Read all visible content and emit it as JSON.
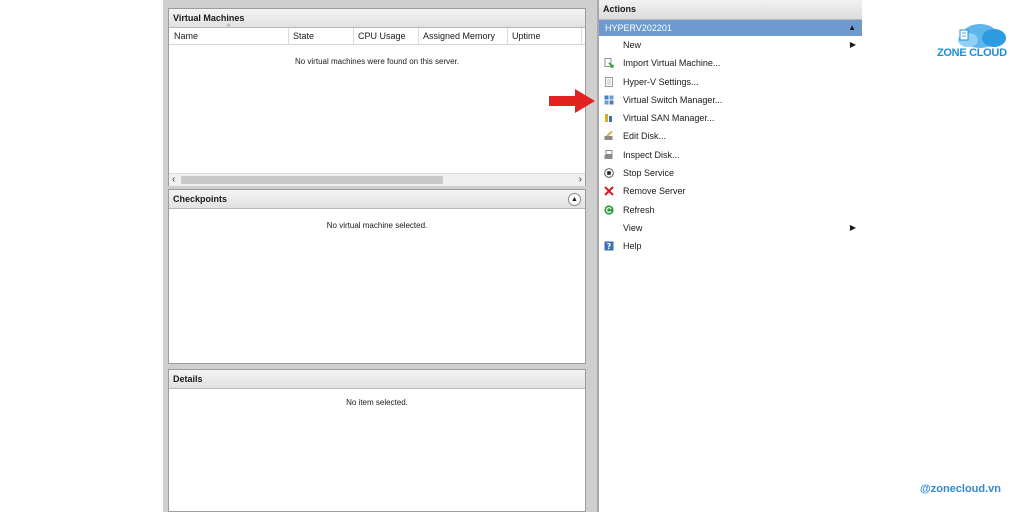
{
  "vm_panel": {
    "title": "Virtual Machines",
    "columns": [
      "Name",
      "State",
      "CPU Usage",
      "Assigned Memory",
      "Uptime"
    ],
    "empty_message": "No virtual machines were found on this server."
  },
  "checkpoints_panel": {
    "title": "Checkpoints",
    "empty_message": "No virtual machine selected."
  },
  "details_panel": {
    "title": "Details",
    "empty_message": "No item selected."
  },
  "actions": {
    "title": "Actions",
    "server_name": "HYPERV202201",
    "items": [
      {
        "label": "New",
        "icon": "none",
        "submenu": true
      },
      {
        "label": "Import Virtual Machine...",
        "icon": "import-icon"
      },
      {
        "label": "Hyper-V Settings...",
        "icon": "settings-page-icon"
      },
      {
        "label": "Virtual Switch Manager...",
        "icon": "switch-icon"
      },
      {
        "label": "Virtual SAN Manager...",
        "icon": "san-icon"
      },
      {
        "label": "Edit Disk...",
        "icon": "edit-disk-icon"
      },
      {
        "label": "Inspect Disk...",
        "icon": "inspect-disk-icon"
      },
      {
        "label": "Stop Service",
        "icon": "stop-icon"
      },
      {
        "label": "Remove Server",
        "icon": "remove-x-icon"
      },
      {
        "label": "Refresh",
        "icon": "refresh-icon"
      },
      {
        "label": "View",
        "icon": "none",
        "submenu": true
      },
      {
        "label": "Help",
        "icon": "help-icon"
      }
    ]
  },
  "branding": {
    "logo_text": "ZONE CLOUD",
    "handle": "@zonecloud.vn"
  },
  "colors": {
    "server_bar": "#6d9bd0",
    "pointer_arrow": "#e32222",
    "brand_blue": "#1c8fd8"
  }
}
